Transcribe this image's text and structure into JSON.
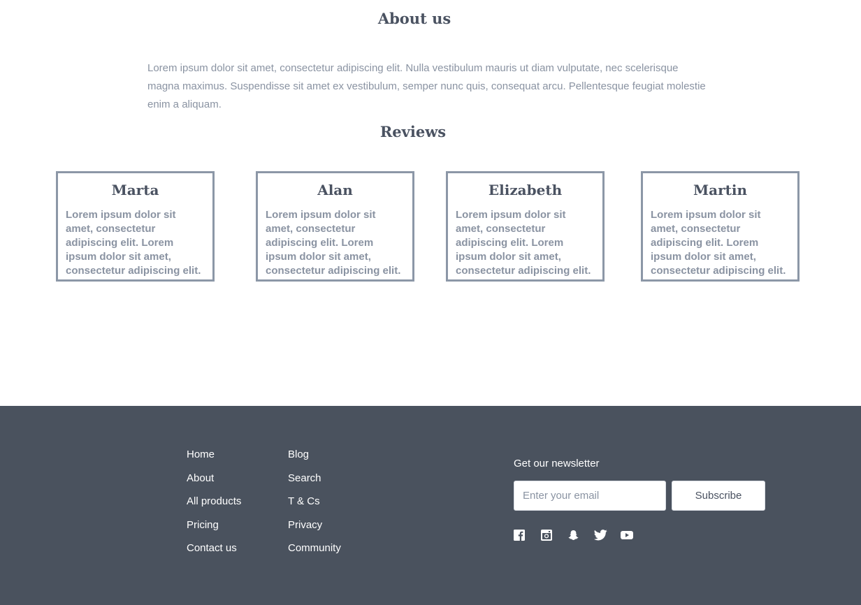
{
  "about": {
    "title": "About us",
    "text": "Lorem ipsum dolor sit amet, consectetur adipiscing elit. Nulla vestibulum mauris ut diam vulputate, nec scelerisque magna maximus. Suspendisse sit amet ex vestibulum, semper nunc quis, consequat arcu. Pellentesque feugiat molestie enim a aliquam."
  },
  "reviews": {
    "title": "Reviews",
    "items": [
      {
        "name": "Marta",
        "text": "Lorem ipsum dolor sit amet, consectetur adipiscing elit. Lorem ipsum dolor sit amet, consectetur adipiscing elit."
      },
      {
        "name": "Alan",
        "text": "Lorem ipsum dolor sit amet, consectetur adipiscing elit. Lorem ipsum dolor sit amet, consectetur adipiscing elit."
      },
      {
        "name": "Elizabeth",
        "text": "Lorem ipsum dolor sit amet, consectetur adipiscing elit. Lorem ipsum dolor sit amet, consectetur adipiscing elit."
      },
      {
        "name": "Martin",
        "text": "Lorem ipsum dolor sit amet, consectetur adipiscing elit. Lorem ipsum dolor sit amet, consectetur adipiscing elit."
      }
    ]
  },
  "footer": {
    "nav_col1": [
      "Home",
      "About",
      "All products",
      "Pricing",
      "Contact us"
    ],
    "nav_col2": [
      "Blog",
      "Search",
      "T & Cs",
      "Privacy",
      "Community"
    ],
    "newsletter": {
      "label": "Get our newsletter",
      "placeholder": "Enter your email",
      "button_label": "Subscribe"
    },
    "social_icons": [
      "facebook-icon",
      "instagram-icon",
      "snapchat-icon",
      "twitter-icon",
      "youtube-icon"
    ]
  },
  "colors": {
    "footer_bg": "#4a525e",
    "heading": "#4a5261",
    "muted_text": "#8a93a2",
    "card_border": "#8c97a7"
  }
}
